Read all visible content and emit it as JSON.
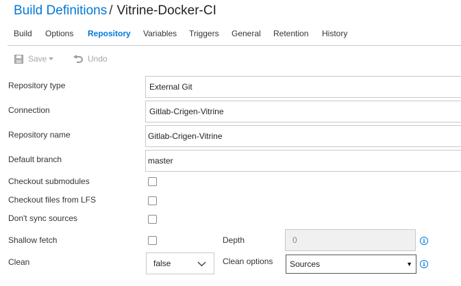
{
  "breadcrumb": {
    "parent": "Build Definitions",
    "separator": "/",
    "current": "Vitrine-Docker-CI"
  },
  "tabs": [
    {
      "label": "Build",
      "active": false
    },
    {
      "label": "Options",
      "active": false
    },
    {
      "label": "Repository",
      "active": true
    },
    {
      "label": "Variables",
      "active": false
    },
    {
      "label": "Triggers",
      "active": false
    },
    {
      "label": "General",
      "active": false
    },
    {
      "label": "Retention",
      "active": false
    },
    {
      "label": "History",
      "active": false
    }
  ],
  "toolbar": {
    "save_label": "Save",
    "undo_label": "Undo",
    "disabled_color": "#a6a6a6"
  },
  "form": {
    "repository_type": {
      "label": "Repository type",
      "value": "External Git"
    },
    "connection": {
      "label": "Connection",
      "value": "Gitlab-Crigen-Vitrine"
    },
    "repository_name": {
      "label": "Repository name",
      "value": "Gitlab-Crigen-Vitrine"
    },
    "default_branch": {
      "label": "Default branch",
      "value": "master"
    },
    "checkout_submodules": {
      "label": "Checkout submodules",
      "checked": false
    },
    "checkout_lfs": {
      "label": "Checkout files from LFS",
      "checked": false
    },
    "dont_sync": {
      "label": "Don't sync sources",
      "checked": false
    },
    "shallow_fetch": {
      "label": "Shallow fetch",
      "checked": false
    },
    "depth": {
      "label": "Depth",
      "value": "0"
    },
    "clean": {
      "label": "Clean",
      "value": "false"
    },
    "clean_options": {
      "label": "Clean options",
      "value": "Sources"
    }
  },
  "colors": {
    "accent": "#0078d7",
    "text": "#333333",
    "border": "#c8c8c8"
  }
}
